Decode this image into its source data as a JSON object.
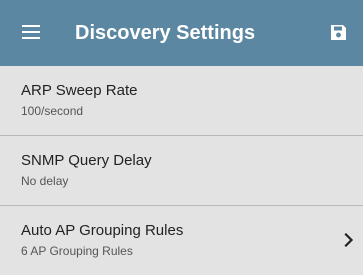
{
  "app_bar": {
    "title": "Discovery Settings",
    "menu_icon": "hamburger-menu-icon",
    "save_icon": "floppy-disk-save-icon",
    "background_color": "#5b87a3"
  },
  "settings": [
    {
      "title": "ARP Sweep Rate",
      "value": "100/second",
      "has_chevron": false
    },
    {
      "title": "SNMP Query Delay",
      "value": "No delay",
      "has_chevron": false
    },
    {
      "title": "Auto AP Grouping Rules",
      "value": "6 AP Grouping Rules",
      "has_chevron": true,
      "chevron_icon": "chevron-right-icon"
    }
  ]
}
